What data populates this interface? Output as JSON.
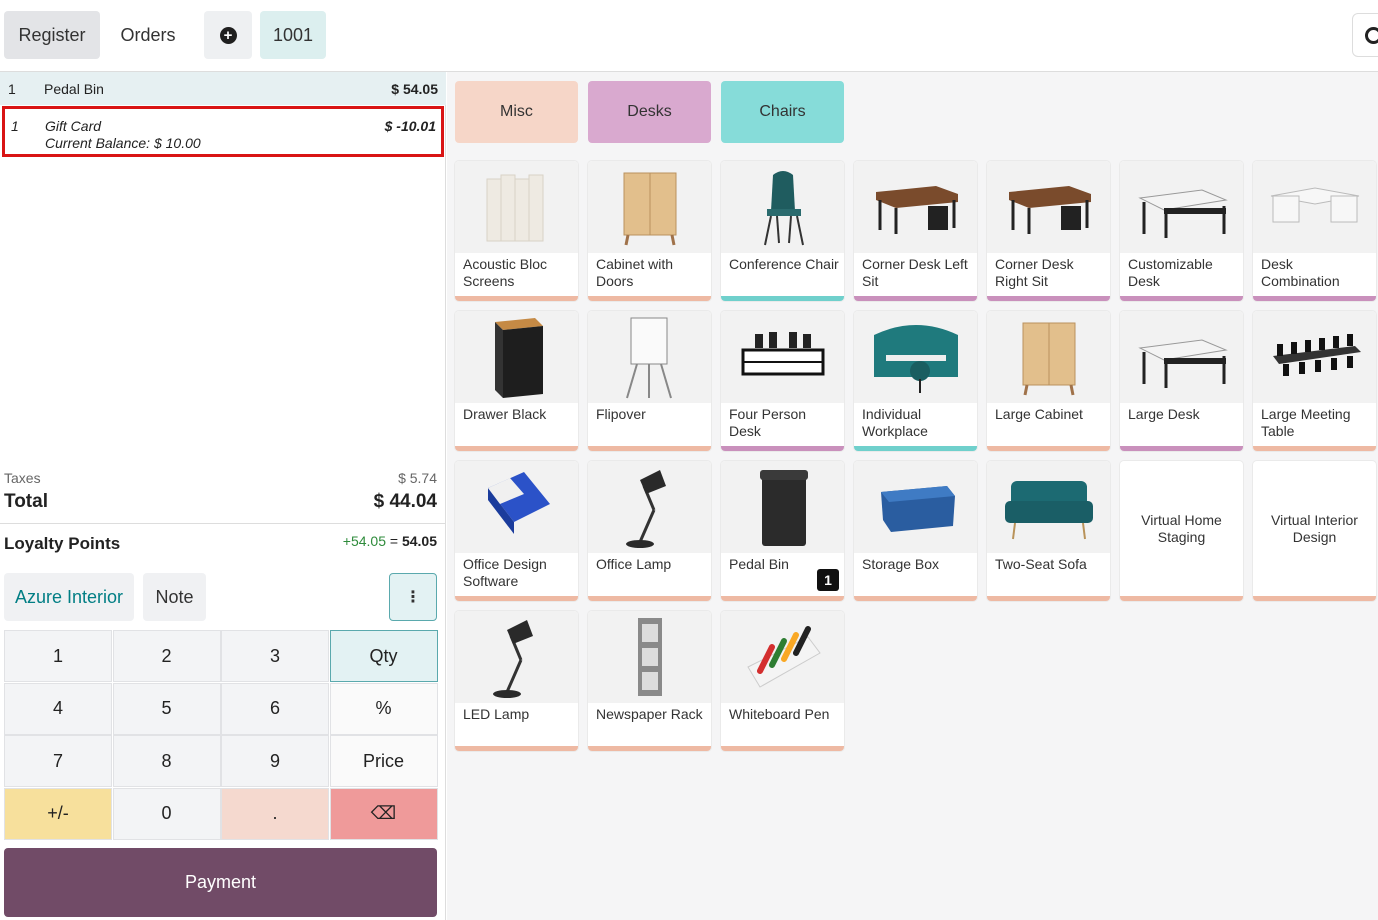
{
  "header": {
    "register_label": "Register",
    "orders_label": "Orders",
    "plus_symbol": "+",
    "order_number": "1001"
  },
  "order_lines": [
    {
      "qty": "1",
      "name": "Pedal Bin",
      "price": "$ 54.05"
    },
    {
      "qty": "1",
      "name": "Gift Card",
      "sub": "Current Balance: $ 10.00",
      "price": "$ -10.01"
    }
  ],
  "summary": {
    "taxes_label": "Taxes",
    "taxes_value": "$ 5.74",
    "total_label": "Total",
    "total_value": "$ 44.04",
    "loyalty_label": "Loyalty Points",
    "loyalty_gain": "+54.05",
    "loyalty_eq": " = ",
    "loyalty_total": "54.05"
  },
  "controls": {
    "customer_label": "Azure Interior",
    "note_label": "Note",
    "more_symbol": "⋮"
  },
  "numpad": {
    "keys": [
      "1",
      "2",
      "3",
      "Qty",
      "4",
      "5",
      "6",
      "%",
      "7",
      "8",
      "9",
      "Price",
      "+/-",
      "0",
      ".",
      "⌫"
    ]
  },
  "payment_label": "Payment",
  "colors": {
    "misc": "#f6d6c8",
    "desks": "#d9a9cf",
    "chairs": "#86dcd9",
    "misc_bar": "#eeb9a3",
    "desks_bar": "#c990bc",
    "chairs_bar": "#6fd0cc",
    "payment": "#714b67",
    "accent": "#017e84"
  },
  "categories": [
    "Misc",
    "Desks",
    "Chairs"
  ],
  "products": [
    {
      "name": "Acoustic Bloc Screens",
      "icon": "screen-icon"
    },
    {
      "name": "Cabinet with Doors",
      "icon": "cabinet-icon"
    },
    {
      "name": "Conference Chair",
      "icon": "chair-icon"
    },
    {
      "name": "Corner Desk Left Sit",
      "icon": "corner-desk-icon"
    },
    {
      "name": "Corner Desk Right Sit",
      "icon": "corner-desk-icon"
    },
    {
      "name": "Customizable Desk",
      "icon": "desk-icon"
    },
    {
      "name": "Desk Combination",
      "icon": "desk-combo-icon"
    },
    {
      "name": "Drawer Black",
      "icon": "drawer-icon"
    },
    {
      "name": "Flipover",
      "icon": "flipover-icon"
    },
    {
      "name": "Four Person Desk",
      "icon": "four-desk-icon"
    },
    {
      "name": "Individual Workplace",
      "icon": "workplace-icon"
    },
    {
      "name": "Large Cabinet",
      "icon": "cabinet-icon"
    },
    {
      "name": "Large Desk",
      "icon": "desk-icon"
    },
    {
      "name": "Large Meeting Table",
      "icon": "meeting-table-icon"
    },
    {
      "name": "Office Design Software",
      "icon": "software-box-icon"
    },
    {
      "name": "Office Lamp",
      "icon": "lamp-icon"
    },
    {
      "name": "Pedal Bin",
      "icon": "bin-icon",
      "badge": "1"
    },
    {
      "name": "Storage Box",
      "icon": "storage-box-icon"
    },
    {
      "name": "Two-Seat Sofa",
      "icon": "sofa-icon"
    },
    {
      "name": "Virtual Home Staging",
      "icon": ""
    },
    {
      "name": "Virtual Interior Design",
      "icon": ""
    },
    {
      "name": "LED Lamp",
      "icon": "lamp-icon"
    },
    {
      "name": "Newspaper Rack",
      "icon": "rack-icon"
    },
    {
      "name": "Whiteboard Pen",
      "icon": "pens-icon"
    }
  ]
}
